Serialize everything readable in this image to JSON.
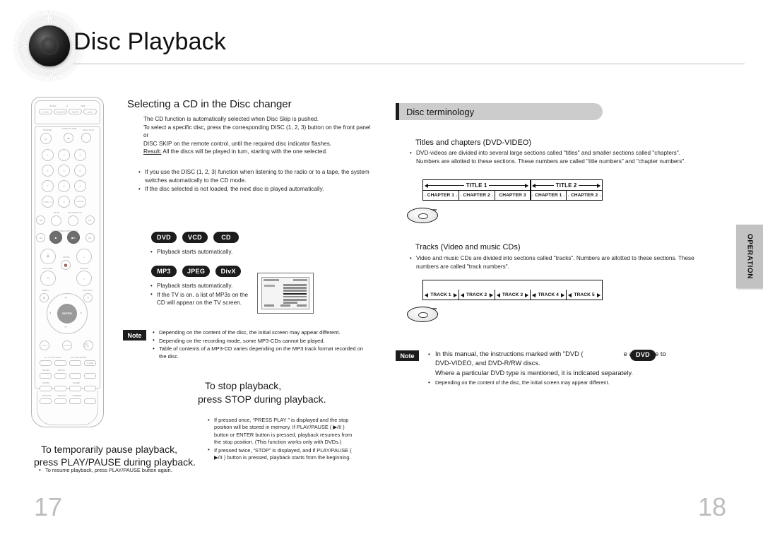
{
  "document": {
    "title": "Disc Playback",
    "page_left": "17",
    "page_right": "18",
    "side_tab": "OPERATION"
  },
  "left_column": {
    "section1": {
      "heading": "Selecting a CD in the Disc changer",
      "paragraph": [
        "The CD function is automatically selected when Disc Skip is pushed.",
        "To select a specific disc, press the corresponding DISC (1, 2, 3) button on the front panel or",
        "DISC SKIP on the remote control, until the required disc indicator flashes."
      ],
      "result_label": "Result:",
      "result_text": " All the discs will be played in turn, starting with the one selected.",
      "bullets": [
        "If you use the DISC (1, 2, 3) function when listening to the radio or to a tape, the system switches automatically to the CD mode.",
        "If the disc selected is not loaded, the next disc is played automatically."
      ]
    },
    "badges_group1": [
      "DVD",
      "VCD",
      "CD"
    ],
    "group1_bullets": [
      "Playback starts automatically."
    ],
    "badges_group2": [
      "MP3",
      "JPEG",
      "DivX"
    ],
    "group2_bullets": [
      "Playback starts automatically.",
      "If the TV is on, a list of MP3s on the CD will appear on the TV screen."
    ],
    "note": {
      "tag": "Note",
      "bullets": [
        "Depending on the content of the disc, the initial screen may appear different.",
        "Depending on the recording mode, some MP3-CDs cannot be played.",
        "Table of contents of a MP3-CD varies depending on the MP3 track format recorded on the disc."
      ]
    },
    "section_stop": {
      "heading_line1": "To stop playback,",
      "heading_line2": "press STOP during playback.",
      "bullets": [
        "If pressed once, “PRESS PLAY  ” is displayed and the stop position will be stored in memory. If PLAY/PAUSE ( ▶/II ) button or ENTER button is pressed, playback resumes from the stop position. (This function works only with DVDs.)",
        "If pressed twice, “STOP” is displayed, and if PLAY/PAUSE ( ▶/II ) button is pressed, playback starts from the beginning."
      ]
    },
    "section_pause": {
      "heading_line1": "To temporarily pause playback,",
      "heading_line2": "press PLAY/PAUSE  during playback.",
      "bullets": [
        "To resume playback, press PLAY/PAUSE button again."
      ]
    }
  },
  "right_column": {
    "header": "Disc terminology",
    "titles_chapters": {
      "heading": "Titles and chapters (DVD-VIDEO)",
      "bullets": [
        "DVD-videos are divided into several large sections called \"titles\" and smaller sections called \"chapters\". Numbers are allotted to these sections. These numbers are called \"title numbers\" and \"chapter numbers\"."
      ],
      "diagram": {
        "titles": [
          {
            "label": "TITLE 1",
            "chapters": [
              "CHAPTER 1",
              "CHAPTER 2",
              "CHAPTER 3"
            ]
          },
          {
            "label": "TITLE 2",
            "chapters": [
              "CHAPTER 1",
              "CHAPTER 2"
            ]
          }
        ]
      }
    },
    "tracks": {
      "heading": "Tracks (Video and music CDs)",
      "bullets": [
        "Video and music CDs are divided into sections called \"tracks\". Numbers are allotted to these sections. These numbers are called \"track numbers\"."
      ],
      "diagram": {
        "tracks": [
          "TRACK 1",
          "TRACK 2",
          "TRACK 3",
          "TRACK 4",
          "TRACK 5"
        ]
      }
    },
    "note": {
      "tag": "Note",
      "main_part1": "In this manual, the instructions marked with \"DVD (",
      "badge": "DVD",
      "main_part2": "e applicable to",
      "main_line2": "DVD-VIDEO, and DVD-R/RW discs.",
      "main_line3": "Where a particular DVD type is mentioned, it is indicated separately.",
      "small_bullet": "Depending on the content of the disc, the initial screen may appear different."
    }
  },
  "remote": {
    "row_labels_top": [
      "BAND",
      "⊖",
      "USB"
    ],
    "source_buttons": [
      "DVD",
      "TUNER",
      "TAPE",
      "AUX"
    ],
    "labels": {
      "power": "POWER",
      "open_close": "OPEN/CLOSE",
      "disc_skip": "DISC SKIP",
      "stop": "STOP",
      "cdripping": "CD RIP/PLAY",
      "transport": "DVD/TAPE/USB/TUNER",
      "volume": "VOLUME",
      "mute": "MUTE",
      "tuning": "TUNING",
      "menu": "MENU",
      "return": "RETURN",
      "enter": "ENTER",
      "info": "INFO",
      "audio": "AUDIO",
      "subtitle": "SUB TITLE",
      "pl_control": "P.L II CONTROL",
      "sound_mode": "SOUND MODE",
      "screen": "SCREEN",
      "slow": "SLOW",
      "mo_st": "MO/ST",
      "repeat": "REPEAT",
      "zoom": "ZOOM",
      "sleep": "SLEEP",
      "timer": "TIMER",
      "remain": "REMAIN",
      "dimmer": "DIMMER"
    },
    "numbers": [
      "1",
      "2",
      "3",
      "4",
      "5",
      "6",
      "7",
      "8",
      "9",
      "TAPE 1/2",
      "0",
      "CANCEL"
    ]
  },
  "colors": {
    "accent_grey": "#8a8a8a",
    "header_bar": "#cccccc",
    "badge_bg": "#1c1c1c",
    "page_number": "#bdbdbd",
    "tab_bg": "#c2c2c2"
  }
}
